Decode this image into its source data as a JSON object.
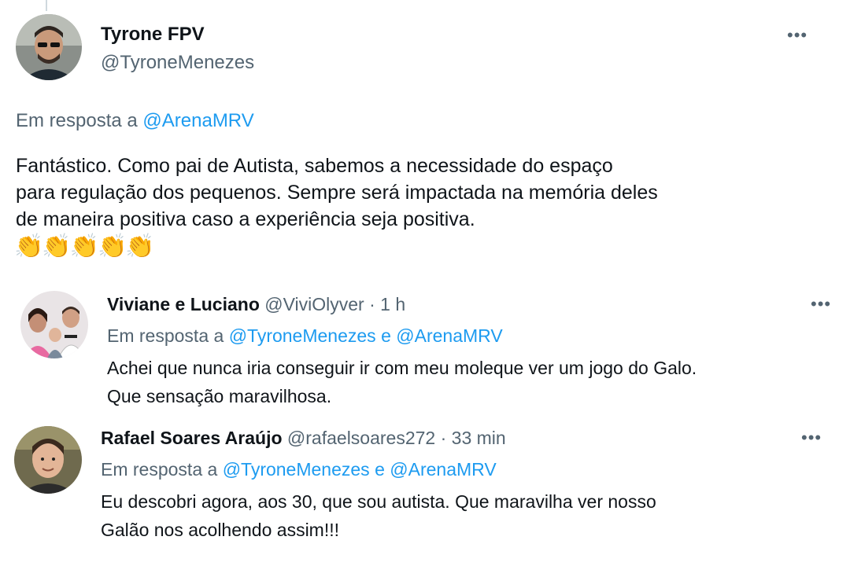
{
  "main_tweet": {
    "display_name": "Tyrone FPV",
    "handle": "@TyroneMenezes",
    "more_label": "•••",
    "reply_prefix": "Em resposta a",
    "reply_mention": "@ArenaMRV",
    "text": "Fantástico. Como pai de Autista, sabemos a necessidade do espaço\npara regulação dos pequenos. Sempre será impactada na memória deles\nde maneira positiva caso a experiência seja positiva.",
    "emojis": "👏👏👏👏👏"
  },
  "replies": [
    {
      "display_name": "Viviane e Luciano",
      "handle": "@ViviOlyver",
      "separator": "·",
      "time": "1 h",
      "more_label": "•••",
      "reply_prefix": "Em resposta a",
      "mention_1": "@TyroneMenezes",
      "conjunction": "e",
      "mention_2": "@ArenaMRV",
      "text": "Achei que nunca iria conseguir ir com meu moleque ver um jogo do Galo.\nQue sensação maravilhosa."
    },
    {
      "display_name": "Rafael Soares Araújo",
      "handle": "@rafaelsoares272",
      "separator": "·",
      "time": "33 min",
      "more_label": "•••",
      "reply_prefix": "Em resposta a",
      "mention_1": "@TyroneMenezes",
      "conjunction": "e",
      "mention_2": "@ArenaMRV",
      "text": "Eu descobri agora, aos 30, que sou autista. Que maravilha ver nosso\nGalão nos acolhendo assim!!!"
    }
  ],
  "colors": {
    "link": "#1d9bf0",
    "secondary_text": "#536471",
    "primary_text": "#0f1419"
  }
}
